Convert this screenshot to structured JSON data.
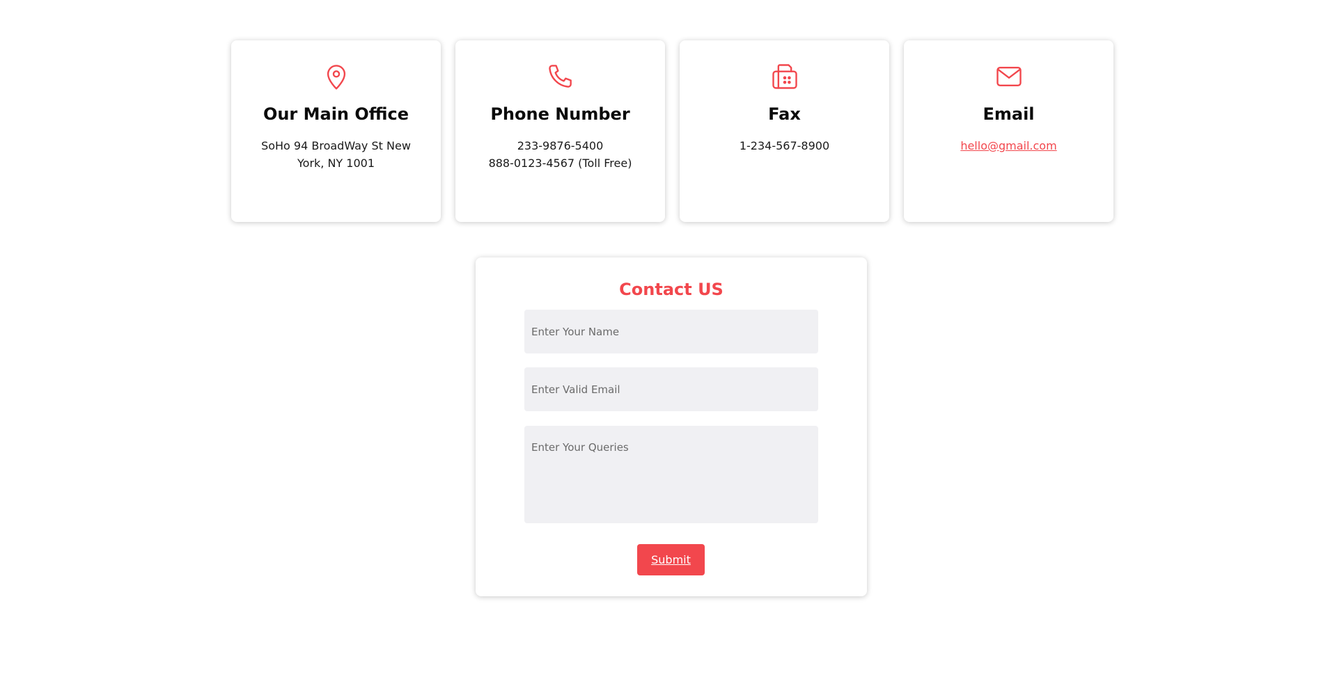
{
  "accent_color": "#f2474d",
  "cards": [
    {
      "icon": "map-pin-icon",
      "title": "Our Main Office",
      "lines": [
        "SoHo 94 BroadWay St New",
        "York, NY 1001"
      ]
    },
    {
      "icon": "phone-icon",
      "title": "Phone Number",
      "lines": [
        "233-9876-5400",
        "888-0123-4567 (Toll Free)"
      ]
    },
    {
      "icon": "fax-icon",
      "title": "Fax",
      "lines": [
        "1-234-567-8900"
      ]
    },
    {
      "icon": "mail-icon",
      "title": "Email",
      "link": "hello@gmail.com"
    }
  ],
  "form": {
    "title": "Contact US",
    "name_placeholder": "Enter Your Name",
    "email_placeholder": "Enter Valid Email",
    "query_placeholder": "Enter Your Queries",
    "submit_label": "Submit"
  }
}
